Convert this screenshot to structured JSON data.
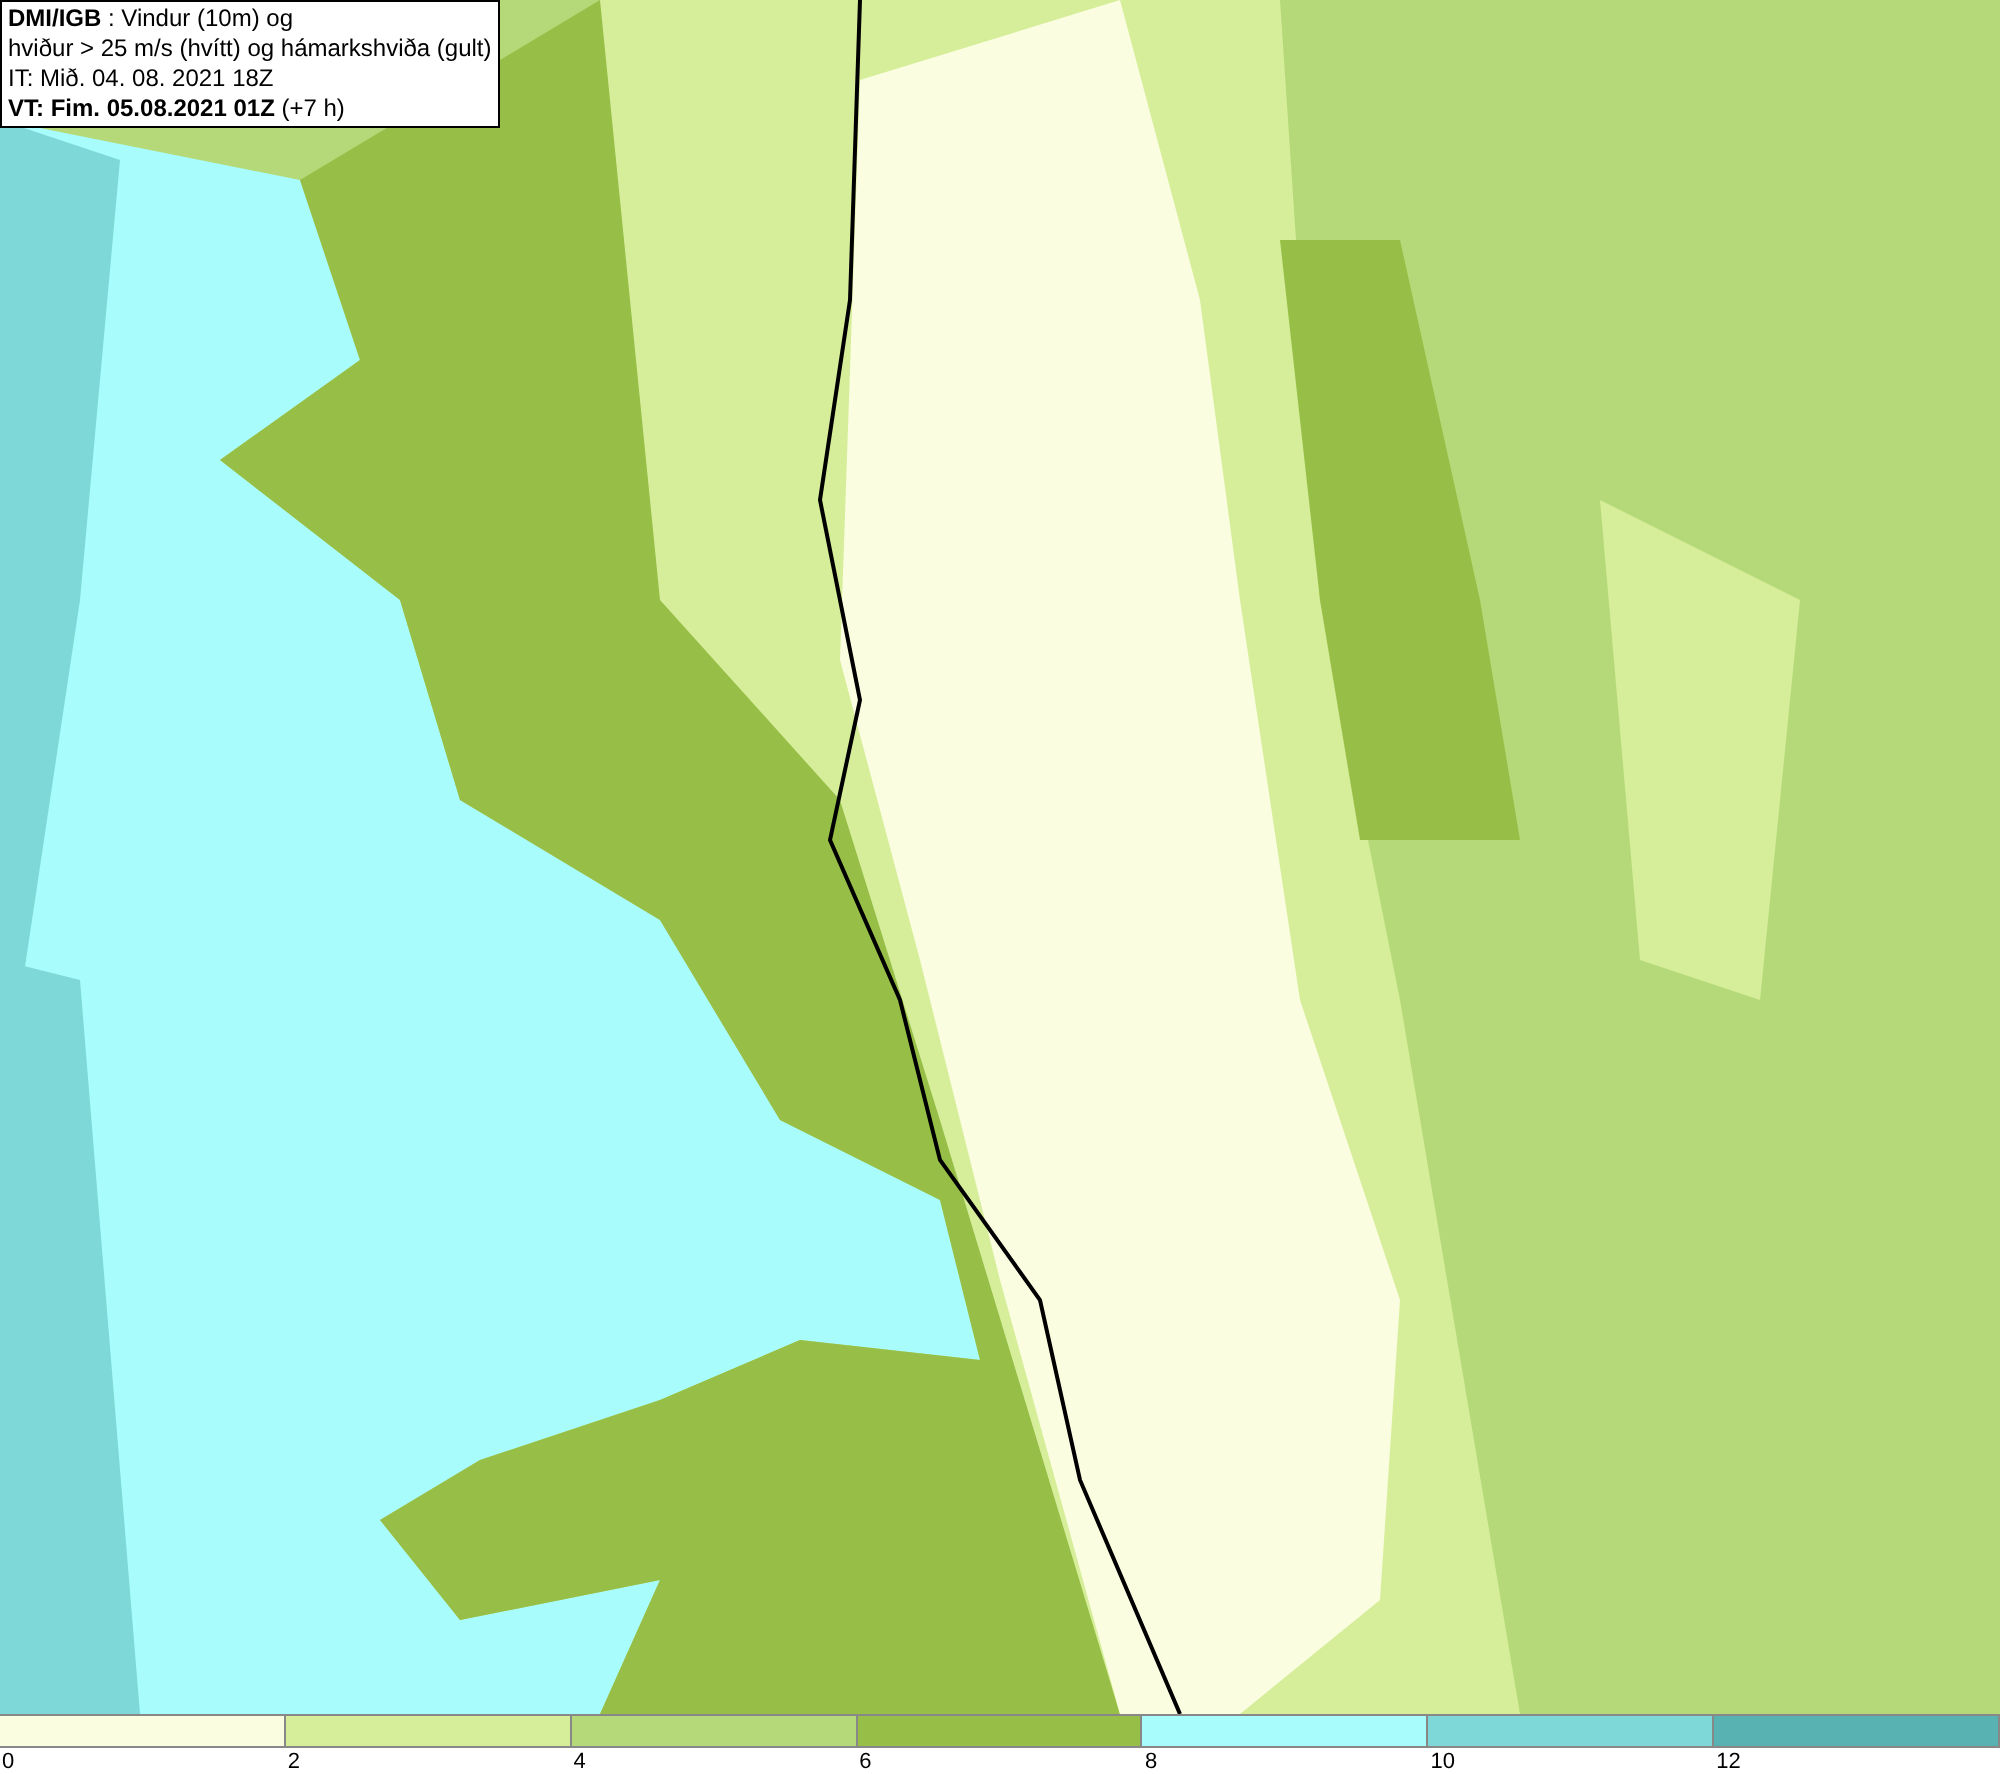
{
  "title_box": {
    "lines": [
      "**DMI/IGB** : Vindur (10m) og",
      "hviður > 25 m/s (hvítt) og hámarkshviða (gult)",
      "IT: Mið. 04. 08. 2021 18Z",
      "**VT: Fim. 05.08.2021 01Z** (+7 h)"
    ]
  },
  "legend": {
    "bins": [
      {
        "color": "#fafde0"
      },
      {
        "color": "#d6ee9a"
      },
      {
        "color": "#b5d978"
      },
      {
        "color": "#97bf47"
      },
      {
        "color": "#a8fcfc"
      },
      {
        "color": "#7fd8d8"
      },
      {
        "color": "#58b2b2"
      }
    ],
    "ticks": [
      "0",
      "2",
      "4",
      "6",
      "8",
      "10",
      "12"
    ]
  }
}
